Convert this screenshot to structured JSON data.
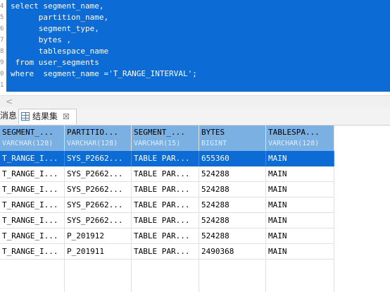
{
  "editor": {
    "line_numbers": [
      "4",
      "5",
      "6",
      "7",
      "8",
      "9",
      "0",
      "1"
    ],
    "lines": [
      "select segment_name,",
      "      partition_name,",
      "      segment_type,",
      "      bytes ,",
      "      tablespace_name",
      " from user_segments",
      "where  segment_name ='T_RANGE_INTERVAL';",
      ""
    ]
  },
  "scroll": {
    "left_arrow": "<"
  },
  "tabs": {
    "messages_label": "消息",
    "result_label": "结果集",
    "result_close": "☒"
  },
  "grid": {
    "columns": [
      {
        "name": "SEGMENT_...",
        "type": "VARCHAR(128)"
      },
      {
        "name": "PARTITIO...",
        "type": "VARCHAR(128)"
      },
      {
        "name": "SEGMENT_...",
        "type": "VARCHAR(15)"
      },
      {
        "name": "BYTES",
        "type": "BIGINT"
      },
      {
        "name": "TABLESPA...",
        "type": "VARCHAR(128)"
      }
    ],
    "rows": [
      [
        "T_RANGE_I...",
        "SYS_P2662...",
        "TABLE PAR...",
        "655360",
        "MAIN"
      ],
      [
        "T_RANGE_I...",
        "SYS_P2662...",
        "TABLE PAR...",
        "524288",
        "MAIN"
      ],
      [
        "T_RANGE_I...",
        "SYS_P2662...",
        "TABLE PAR...",
        "524288",
        "MAIN"
      ],
      [
        "T_RANGE_I...",
        "SYS_P2662...",
        "TABLE PAR...",
        "524288",
        "MAIN"
      ],
      [
        "T_RANGE_I...",
        "SYS_P2662...",
        "TABLE PAR...",
        "524288",
        "MAIN"
      ],
      [
        "T_RANGE_I...",
        "P_201912",
        "TABLE PAR...",
        "524288",
        "MAIN"
      ],
      [
        "T_RANGE_I...",
        "P_201911",
        "TABLE PAR...",
        "2490368",
        "MAIN"
      ]
    ],
    "selected_row": 0
  },
  "colors": {
    "selection": "#0c6bd4",
    "header": "#7ab0e2"
  }
}
